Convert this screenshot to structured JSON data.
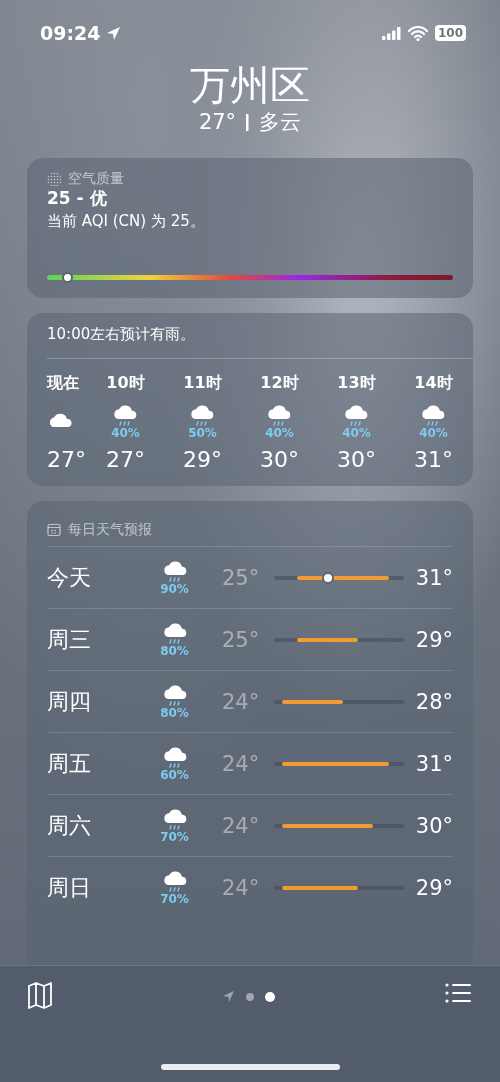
{
  "status_bar": {
    "time": "09:24",
    "battery": "100"
  },
  "location": {
    "name": "万州区",
    "temperature": "27°",
    "condition": "多云"
  },
  "air_quality": {
    "title": "空气质量",
    "value": "25 - 优",
    "description": "当前 AQI (CN) 为 25。",
    "level": 0.05
  },
  "hourly": {
    "summary": "10:00左右预计有雨。",
    "items": [
      {
        "time": "现在",
        "kind": "cloud",
        "temp": "27°"
      },
      {
        "time": "10时",
        "kind": "rain",
        "chance": "40%",
        "temp": "27°"
      },
      {
        "time": "11时",
        "kind": "rain",
        "chance": "50%",
        "temp": "29°"
      },
      {
        "time": "12时",
        "kind": "rain",
        "chance": "40%",
        "temp": "30°"
      },
      {
        "time": "13时",
        "kind": "rain",
        "chance": "40%",
        "temp": "30°"
      },
      {
        "time": "14时",
        "kind": "rain",
        "chance": "40%",
        "temp": "31°"
      }
    ]
  },
  "daily": {
    "title": "每日天气预报",
    "days": [
      {
        "day": "今天",
        "kind": "rain",
        "chance": "90%",
        "low": "25°",
        "high": "31°",
        "current": true
      },
      {
        "day": "周三",
        "kind": "rain",
        "chance": "80%",
        "low": "25°",
        "high": "29°",
        "current": false
      },
      {
        "day": "周四",
        "kind": "rain",
        "chance": "80%",
        "low": "24°",
        "high": "28°",
        "current": false
      },
      {
        "day": "周五",
        "kind": "rain",
        "chance": "60%",
        "low": "24°",
        "high": "31°",
        "current": false
      },
      {
        "day": "周六",
        "kind": "rain",
        "chance": "70%",
        "low": "24°",
        "high": "30°",
        "current": false
      },
      {
        "day": "周日",
        "kind": "rain",
        "chance": "70%",
        "low": "24°",
        "high": "29°",
        "current": false
      }
    ]
  },
  "pages": [
    {
      "kind": "location",
      "selected": false
    },
    {
      "kind": "dot",
      "selected": false
    },
    {
      "kind": "dot",
      "selected": true
    }
  ]
}
